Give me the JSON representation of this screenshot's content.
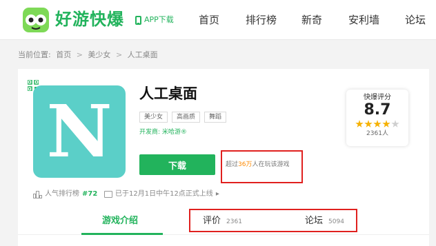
{
  "header": {
    "brand": "好游快爆",
    "app_download": "APP下载",
    "nav": [
      "首页",
      "排行榜",
      "新奇",
      "安利墙",
      "论坛"
    ]
  },
  "breadcrumb": {
    "prefix": "当前位置:",
    "items": [
      "首页",
      "美少女",
      "人工桌面"
    ],
    "separator": ">"
  },
  "app": {
    "icon_letter": "N",
    "name": "人工桌面",
    "tags": [
      "美少女",
      "高画质",
      "舞蹈"
    ],
    "developer": "开发商: 米哈游®",
    "download_label": "下载",
    "players_prefix": "超过",
    "players_count": "36万",
    "players_suffix": "人在玩该游戏",
    "rank_label": "人气排行榜",
    "rank_value": "#72",
    "launch_info": "已于12月1日中午12点正式上线",
    "launch_arrow": "▸"
  },
  "score": {
    "title": "快爆评分",
    "value": "8.7",
    "stars": 4,
    "stars_max": 5,
    "count": "2361人"
  },
  "tabs": [
    {
      "label": "游戏介绍",
      "count": ""
    },
    {
      "label": "评价",
      "count": "2361"
    },
    {
      "label": "论坛",
      "count": "5094"
    }
  ],
  "colors": {
    "brand_green": "#22b35c",
    "icon_teal": "#5bcfc8",
    "highlight_orange": "#ff8a00",
    "annotation_red": "#e0201e"
  }
}
